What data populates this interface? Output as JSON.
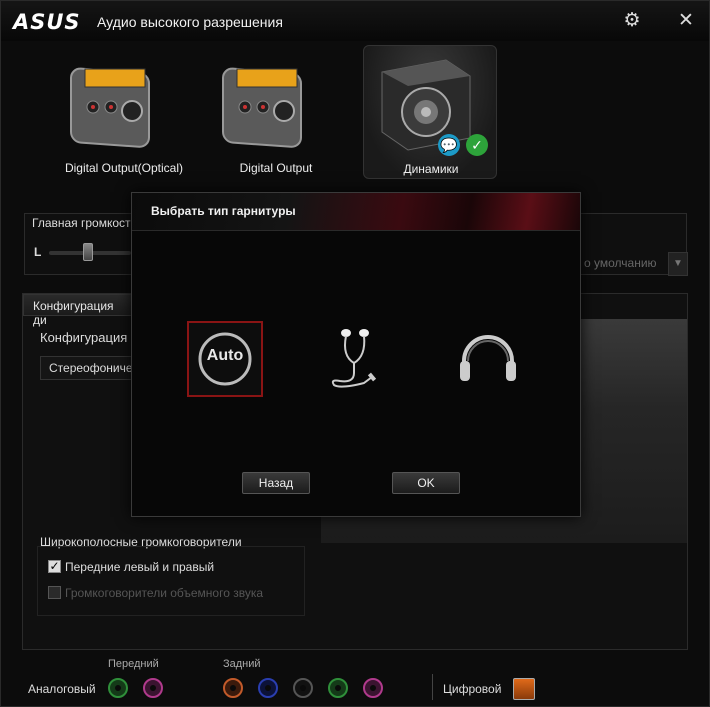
{
  "window": {
    "logo": "ASUS",
    "title": "Аудио высокого разрешения"
  },
  "devices": [
    {
      "label": "Digital Output(Optical)",
      "icon": "digital-output-device-icon"
    },
    {
      "label": "Digital Output",
      "icon": "digital-output-device-icon"
    },
    {
      "label": "Динамики",
      "icon": "speaker-device-icon",
      "selected": true
    }
  ],
  "volume": {
    "title": "Главная громкость",
    "left_label": "L",
    "default_label": "о умолчанию"
  },
  "config": {
    "tab_label": "Конфигурация ди",
    "field_label": "Конфигурация д",
    "value": "Стереофоничес"
  },
  "wideband": {
    "title": "Широкополосные громкоговорители",
    "options": [
      {
        "label": "Передние левый и правый",
        "checked": true,
        "enabled": true
      },
      {
        "label": "Громкоговорители объемного звука",
        "checked": false,
        "enabled": false
      }
    ]
  },
  "jacks": {
    "analog_label": "Аналоговый",
    "front_label": "Передний",
    "rear_label": "Задний",
    "digital_label": "Цифровой",
    "colors": [
      "#2f8f3a",
      "#b03a8c",
      "#c25a2a",
      "#2a3eb0",
      "#222222",
      "#2f8f3a",
      "#b03a8c"
    ]
  },
  "modal": {
    "title": "Выбрать тип гарнитуры",
    "options": [
      {
        "label": "Auto",
        "icon": "auto-detect-icon",
        "selected": true
      },
      {
        "icon": "earbuds-icon",
        "selected": false
      },
      {
        "icon": "headphones-icon",
        "selected": false
      }
    ],
    "back_label": "Назад",
    "ok_label": "OK"
  },
  "colors": {
    "accent": "#8a1414",
    "background": "#0c0c0c"
  }
}
